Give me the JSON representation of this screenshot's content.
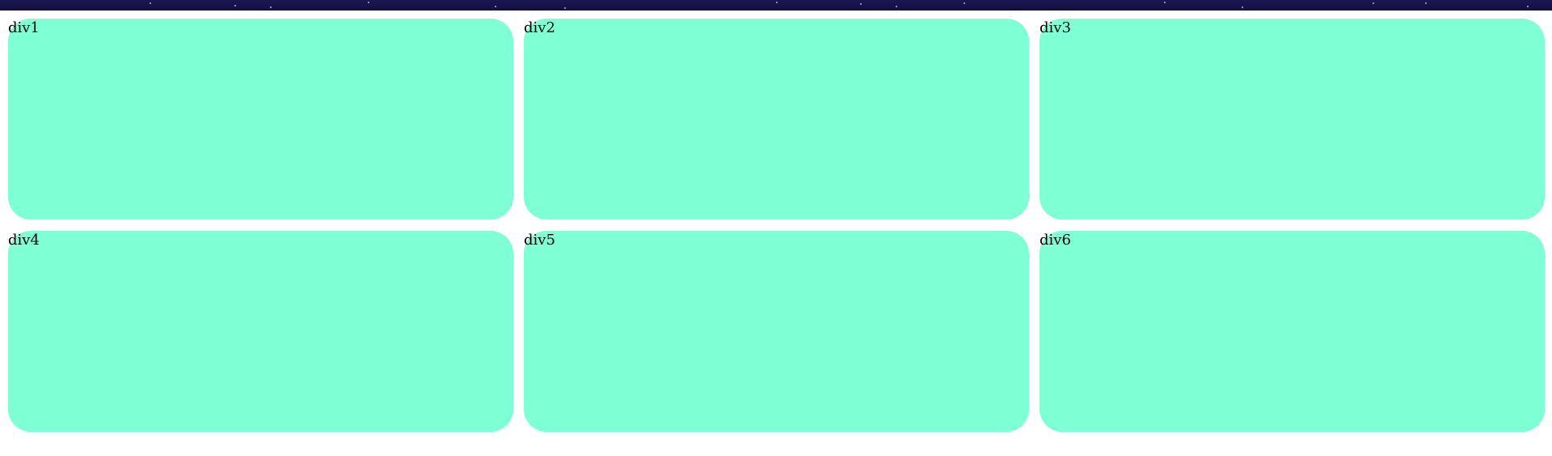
{
  "colors": {
    "banner_background": "#1b1650",
    "tile_background": "#7fffd4",
    "text": "#000000"
  },
  "tiles": [
    {
      "label": "div1"
    },
    {
      "label": "div2"
    },
    {
      "label": "div3"
    },
    {
      "label": "div4"
    },
    {
      "label": "div5"
    },
    {
      "label": "div6"
    }
  ]
}
